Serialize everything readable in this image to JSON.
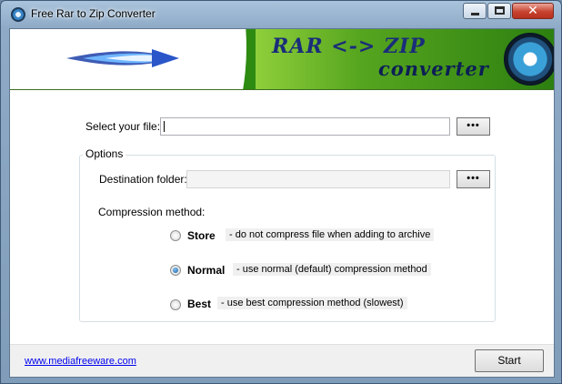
{
  "window": {
    "title": "Free Rar to Zip Converter",
    "close_glyph": "✕"
  },
  "banner": {
    "line1": "RAR <-> ZIP",
    "line2": "converter"
  },
  "form": {
    "select_file_label": "Select your file:",
    "select_file_value": "",
    "browse_label": "•••",
    "options_title": "Options",
    "destination_label": "Destination folder:",
    "destination_value": "",
    "compression_label": "Compression method:"
  },
  "compression": {
    "selected": "Normal",
    "options": [
      {
        "name": "Store",
        "desc": "- do not compress file when adding to archive",
        "checked": false
      },
      {
        "name": "Normal",
        "desc": "- use normal (default) compression method",
        "checked": true
      },
      {
        "name": "Best",
        "desc": "- use best compression method (slowest)",
        "checked": false
      }
    ]
  },
  "footer": {
    "link": "www.mediafreeware.com",
    "start_label": "Start"
  },
  "colors": {
    "banner_green": "#2e8b11",
    "banner_text": "#1a2d7a",
    "link": "#0000ee",
    "radio_checked": "#1f5f9e"
  },
  "icons": [
    "app-icon",
    "minimize-icon",
    "maximize-icon",
    "close-icon",
    "arrow-graphic",
    "converter-logo-icon"
  ]
}
